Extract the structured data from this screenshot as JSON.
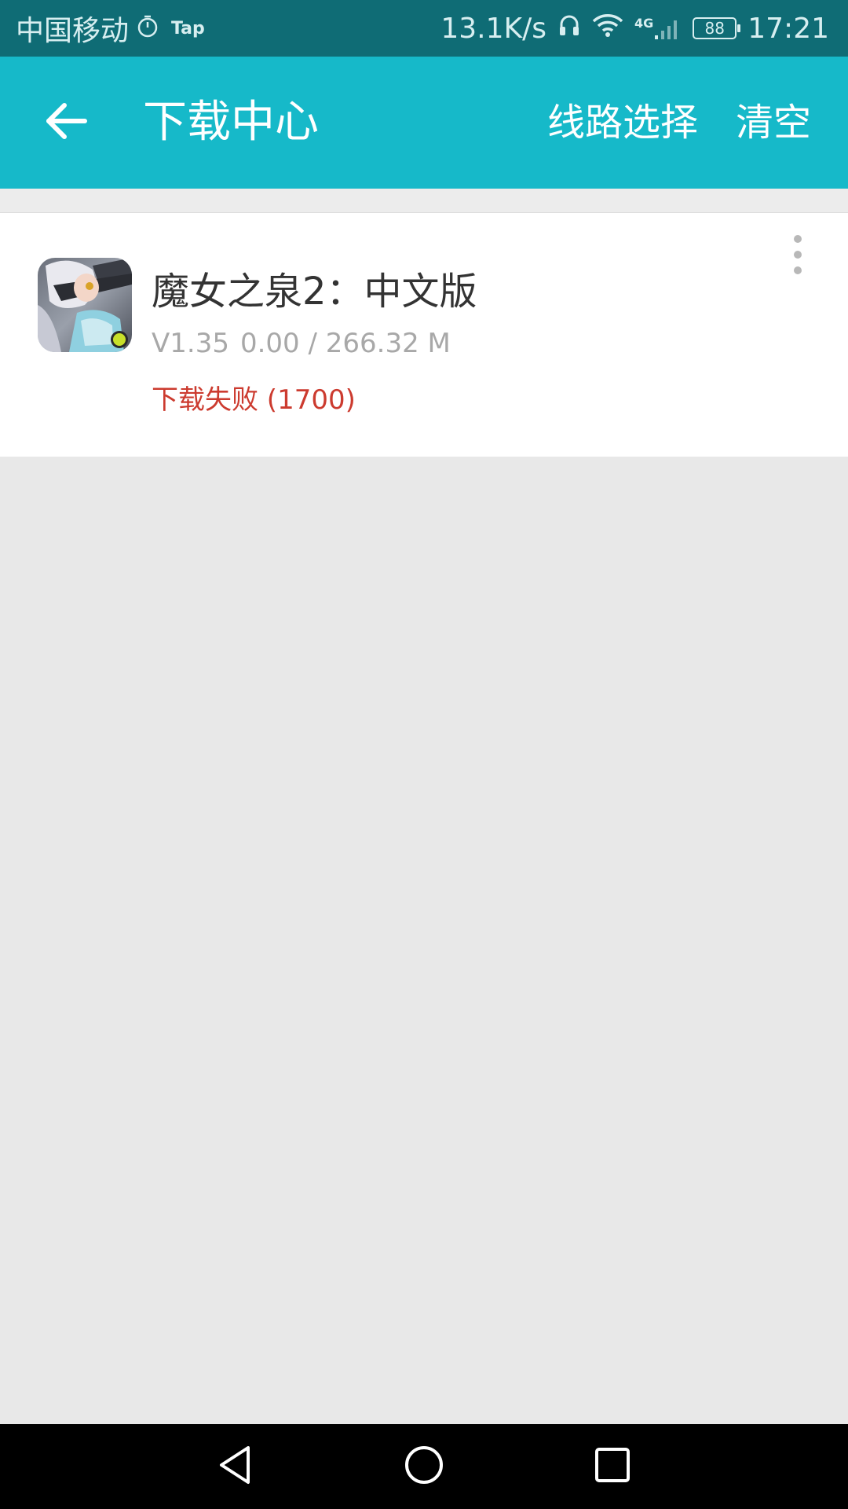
{
  "status_bar": {
    "carrier": "中国移动",
    "tap_label": "Tap",
    "speed": "13.1K/s",
    "network_type": "4G",
    "battery": "88",
    "time": "17:21"
  },
  "app_bar": {
    "title": "下载中心",
    "route_select": "线路选择",
    "clear": "清空"
  },
  "downloads": [
    {
      "name": "魔女之泉2：中文版",
      "version": "V1.35",
      "progress": "0.00 / 266.32 M",
      "progress_fraction": 0,
      "status": "下载失败 (1700)"
    }
  ],
  "colors": {
    "status_bar": "#0f6c75",
    "app_bar": "#16b9c9",
    "background": "#e8e8e8",
    "error": "#cc3b2f"
  },
  "icons": {
    "back": "arrow-left-icon",
    "more": "more-vertical-icon",
    "nav_back": "triangle-back-icon",
    "nav_home": "circle-home-icon",
    "nav_recent": "square-recent-icon"
  }
}
